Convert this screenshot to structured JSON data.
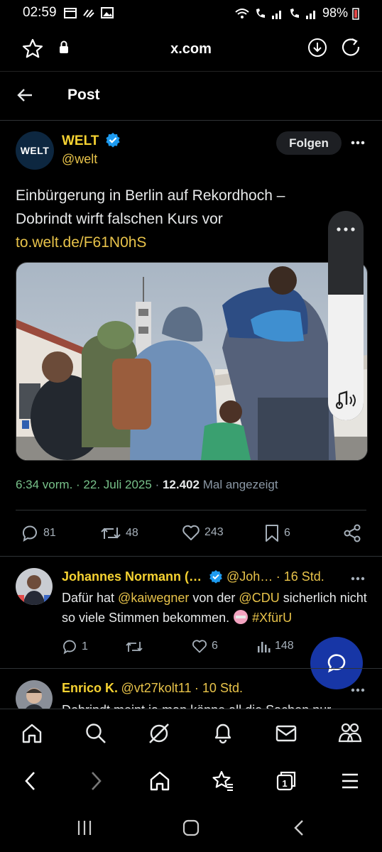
{
  "status_bar": {
    "time": "02:59",
    "battery": "98%"
  },
  "browser": {
    "url": "x.com"
  },
  "header": {
    "title": "Post"
  },
  "post": {
    "author_name": "WELT",
    "author_handle": "@welt",
    "avatar_text": "WELT",
    "follow_label": "Folgen",
    "text": "Einbürgerung in Berlin auf Rekordhoch – Dobrindt wirft falschen Kurs vor",
    "link": "to.welt.de/F61N0hS",
    "time": "6:34 vorm.",
    "date": "22. Juli 2025",
    "views": "12.402",
    "views_label": "Mal angezeigt",
    "replies": "81",
    "reposts": "48",
    "likes": "243",
    "bookmarks": "6"
  },
  "volume_overlay": {
    "level_fraction": 0.6
  },
  "replies": [
    {
      "name": "Johannes Normann (…",
      "handle": "@Joh…",
      "time": "16 Std.",
      "text_a": "Dafür hat ",
      "mention1": "@kaiwegner",
      "text_b": " von der ",
      "mention2": "@CDU",
      "text_c": " sicherlich nicht so viele Stimmen bekommen. ",
      "hashtag": "#XfürU",
      "replies": "1",
      "likes": "6",
      "views": "148"
    },
    {
      "name": "Enrico K.",
      "handle": "@vt27kolt11",
      "time": "10 Std.",
      "text": "Dobrindt meint ja man könne all die Sachen nur"
    }
  ],
  "colors": {
    "accent_yellow": "#f5d232",
    "link_yellow": "#e8c34a",
    "meta_green": "#78c28a",
    "fab_blue": "#1736a6",
    "verified_blue": "#1d9bf0"
  }
}
